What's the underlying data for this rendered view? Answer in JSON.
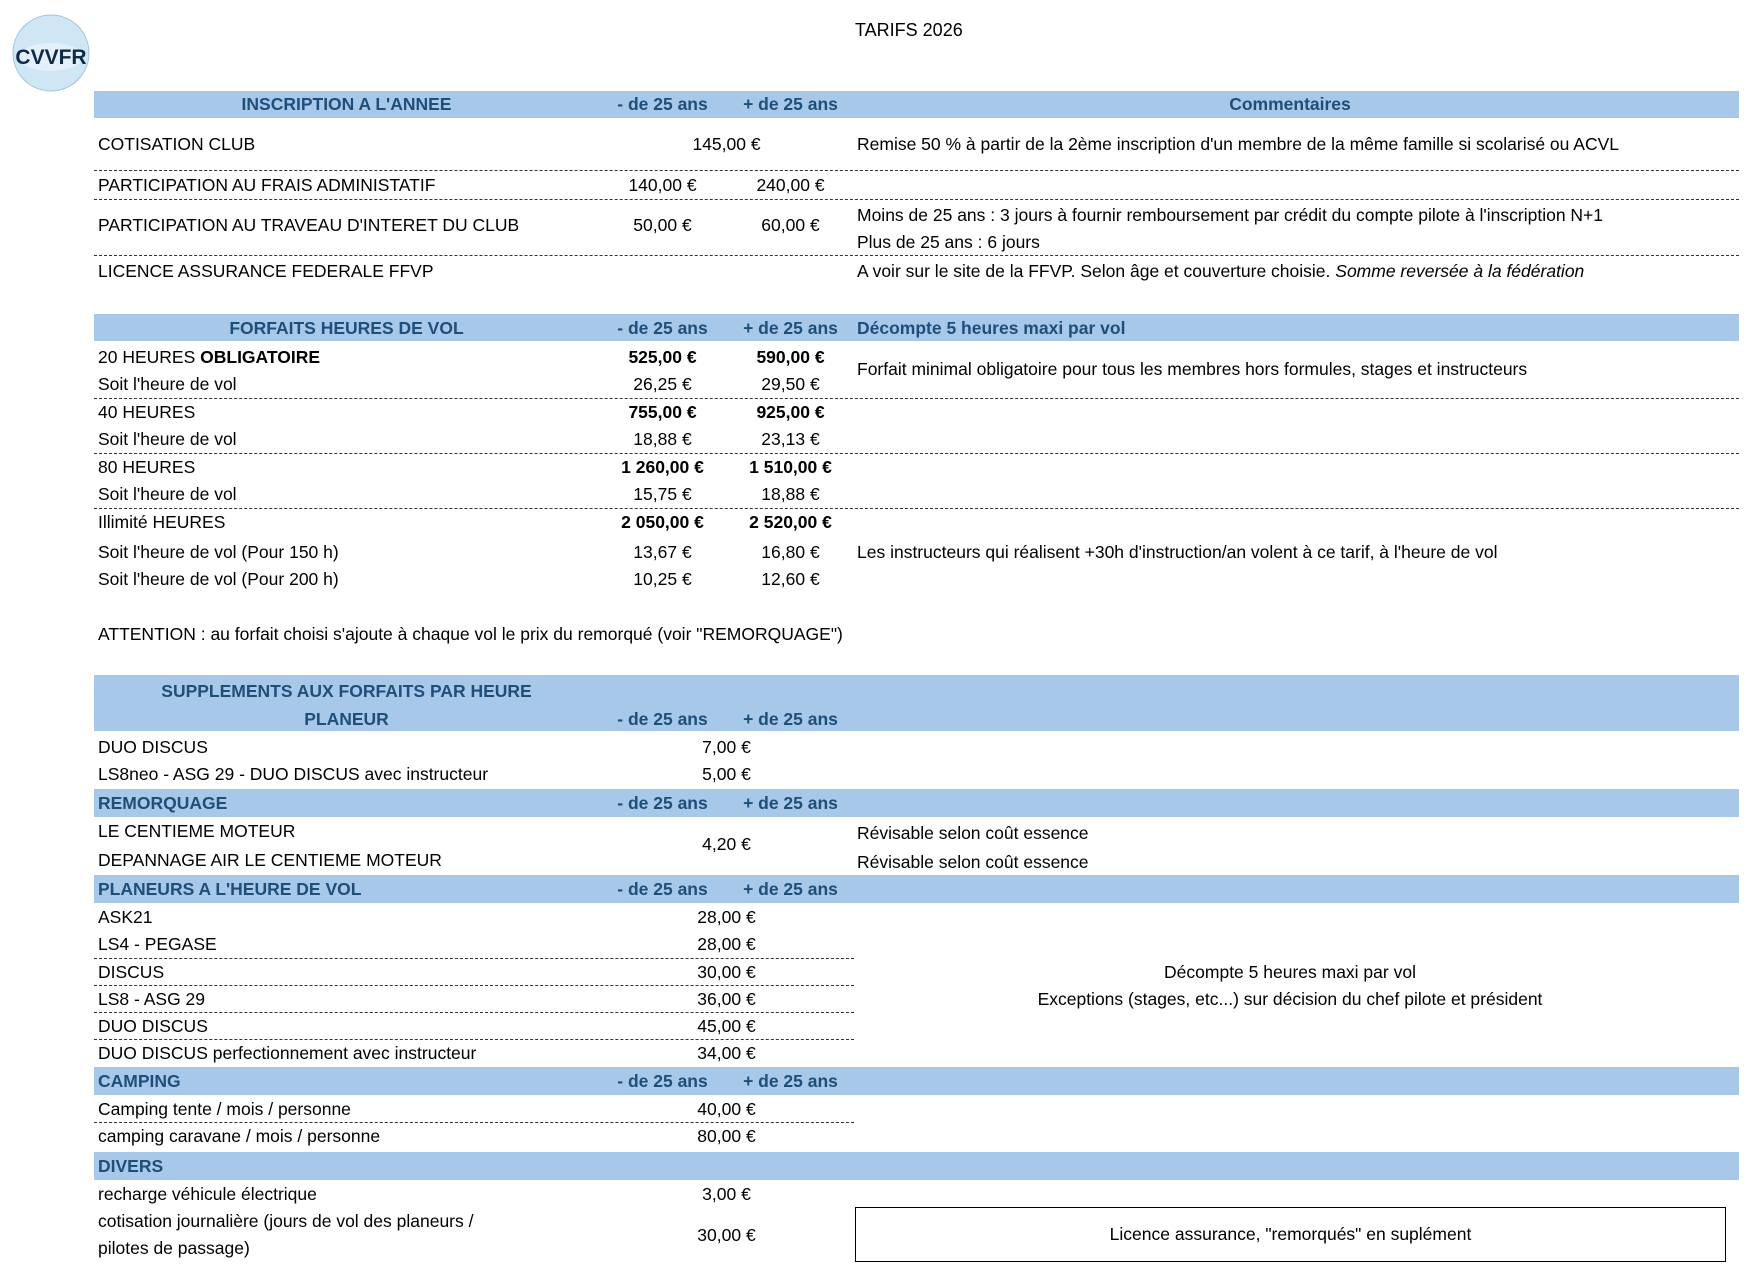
{
  "title": "TARIFS 2026",
  "logo": {
    "text": "CVVFR"
  },
  "inscription": {
    "header": "INSCRIPTION A L'ANNEE",
    "col_under": "- de 25 ans",
    "col_over": "+ de 25 ans",
    "col_comment": "Commentaires",
    "rows": [
      {
        "label": "COTISATION CLUB",
        "price": "145,00 €",
        "comment": "Remise 50 % à partir de la 2ème inscription d'un membre de la même famille si scolarisé ou ACVL"
      },
      {
        "label": "PARTICIPATION AU FRAIS ADMINISTATIF",
        "under": "140,00 €",
        "over": "240,00 €"
      },
      {
        "label": "PARTICIPATION AU TRAVEAU D'INTERET DU CLUB",
        "under": "50,00 €",
        "over": "60,00 €",
        "comment1": "Moins de 25 ans : 3 jours à fournir remboursement par crédit du compte pilote à l'inscription N+1",
        "comment2": "Plus de 25 ans : 6 jours"
      },
      {
        "label": "LICENCE ASSURANCE FEDERALE FFVP",
        "comment": "A voir sur le site de la FFVP. Selon âge et couverture choisie. ",
        "comment_italic": "Somme reversée à la fédération"
      }
    ]
  },
  "forfaits": {
    "header": "FORFAITS HEURES DE VOL",
    "col_under": "- de 25 ans",
    "col_over": "+ de 25 ans",
    "col_comment": "Décompte 5 heures maxi par vol",
    "rows": [
      {
        "label": "20 HEURES ",
        "label_bold": "OBLIGATOIRE",
        "under": "525,00 €",
        "over": "590,00 €"
      },
      {
        "label": "Soit l'heure de vol",
        "under": "26,25 €",
        "over": "29,50 €"
      },
      {
        "label": "40 HEURES",
        "under": "755,00 €",
        "over": "925,00 €"
      },
      {
        "label": "Soit l'heure de vol",
        "under": "18,88 €",
        "over": "23,13 €"
      },
      {
        "label": "80 HEURES",
        "under": "1 260,00 €",
        "over": "1 510,00 €"
      },
      {
        "label": "Soit l'heure de vol",
        "under": "15,75 €",
        "over": "18,88 €"
      },
      {
        "label": "Illimité HEURES",
        "under": "2 050,00 €",
        "over": "2 520,00 €"
      },
      {
        "label": "Soit l'heure de vol (Pour 150 h)",
        "under": "13,67 €",
        "over": "16,80 €"
      },
      {
        "label": "Soit l'heure de vol (Pour 200 h)",
        "under": "10,25 €",
        "over": "12,60 €"
      }
    ],
    "comment_20h": "Forfait minimal obligatoire pour tous les membres hors formules, stages et instructeurs",
    "comment_instructeurs": "Les instructeurs qui réalisent +30h d'instruction/an volent à ce tarif, à l'heure de vol",
    "attention": "ATTENTION : au forfait choisi s'ajoute à chaque vol le prix du remorqué (voir \"REMORQUAGE\")"
  },
  "supplements": {
    "header_line1": "SUPPLEMENTS AUX FORFAITS PAR HEURE",
    "header_line2": "PLANEUR",
    "col_under": "- de 25 ans",
    "col_over": "+ de 25 ans",
    "rows": [
      {
        "label": "DUO DISCUS",
        "price": "7,00 €"
      },
      {
        "label": "LS8neo - ASG 29 - DUO DISCUS avec instructeur",
        "price": "5,00 €"
      }
    ]
  },
  "remorquage": {
    "header": "REMORQUAGE",
    "col_under": "- de 25 ans",
    "col_over": "+ de 25 ans",
    "rows": [
      {
        "label": "LE CENTIEME MOTEUR",
        "comment": "Révisable selon coût essence"
      },
      {
        "label": "DEPANNAGE AIR LE CENTIEME MOTEUR",
        "comment": "Révisable selon coût essence"
      }
    ],
    "price": "4,20 €"
  },
  "planeurs": {
    "header": "PLANEURS A L'HEURE DE VOL",
    "col_under": "- de 25 ans",
    "col_over": "+ de 25 ans",
    "rows": [
      {
        "label": "ASK21",
        "price": "28,00 €"
      },
      {
        "label": "LS4 - PEGASE",
        "price": "28,00 €"
      },
      {
        "label": "DISCUS",
        "price": "30,00 €"
      },
      {
        "label": "LS8 - ASG 29",
        "price": "36,00 €"
      },
      {
        "label": "DUO DISCUS",
        "price": "45,00 €"
      },
      {
        "label": "DUO DISCUS perfectionnement avec instructeur",
        "price": "34,00 €"
      }
    ],
    "comment1": "Décompte 5 heures maxi par vol",
    "comment2": "Exceptions (stages, etc...) sur décision du chef pilote et président"
  },
  "camping": {
    "header": "CAMPING",
    "col_under": "- de 25 ans",
    "col_over": "+ de 25 ans",
    "rows": [
      {
        "label": "Camping tente / mois / personne",
        "price": "40,00 €"
      },
      {
        "label": "camping caravane / mois / personne",
        "price": "80,00 €"
      }
    ]
  },
  "divers": {
    "header": "DIVERS",
    "rows": [
      {
        "label": "recharge véhicule électrique",
        "price": "3,00 €"
      },
      {
        "label_line1": "cotisation journalière (jours de vol des planeurs /",
        "label_line2": "pilotes de passage)",
        "price": "30,00 €"
      }
    ],
    "note": "Licence assurance, \"remorqués\" en suplément"
  }
}
